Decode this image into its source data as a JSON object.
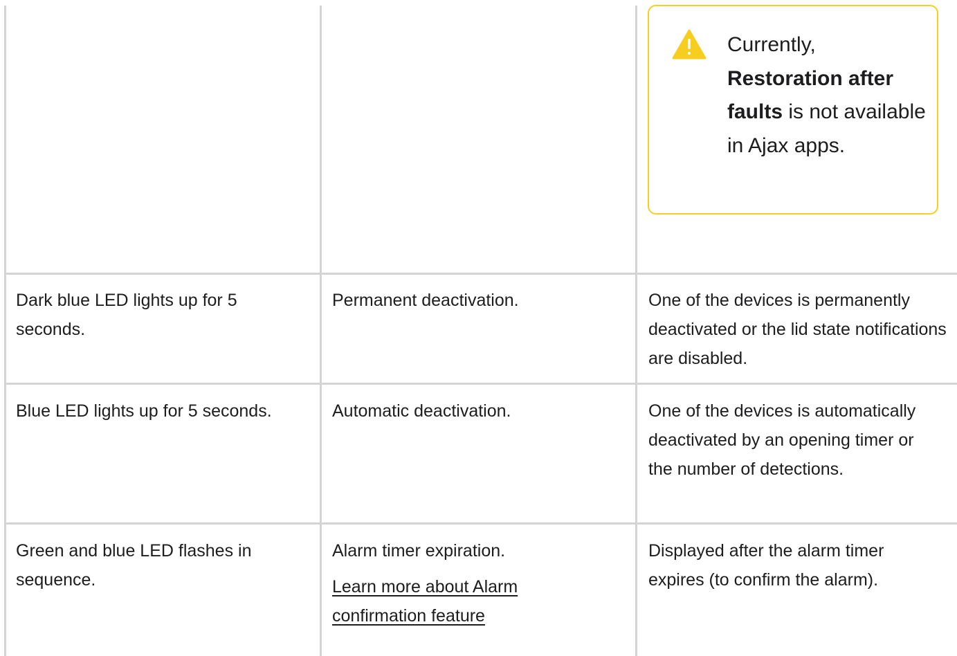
{
  "warning": {
    "icon": "warning-triangle-icon",
    "accent_color": "#f5ce1f",
    "text_before": "Currently, ",
    "text_bold": "Restoration after faults",
    "text_after": " is not available in Ajax apps."
  },
  "rows": [
    {
      "indication": "Dark blue LED lights up for 5 seconds.",
      "event": "Permanent deactivation.",
      "note": "One of the devices is permanently deactivated or the lid state notifications are disabled."
    },
    {
      "indication": "Blue LED lights up for 5 seconds.",
      "event": "Automatic deactivation.",
      "note": "One of the devices is automatically deactivated by an opening timer or the number of detections."
    },
    {
      "indication": "Green and blue LED flashes in sequence.",
      "event": "Alarm timer expiration.",
      "event_link": "Learn more about Alarm confirmation feature",
      "note": "Displayed after the alarm timer expires (to confirm the alarm)."
    }
  ],
  "colors": {
    "border": "#d4d4d4",
    "text": "#1d1d1f"
  }
}
